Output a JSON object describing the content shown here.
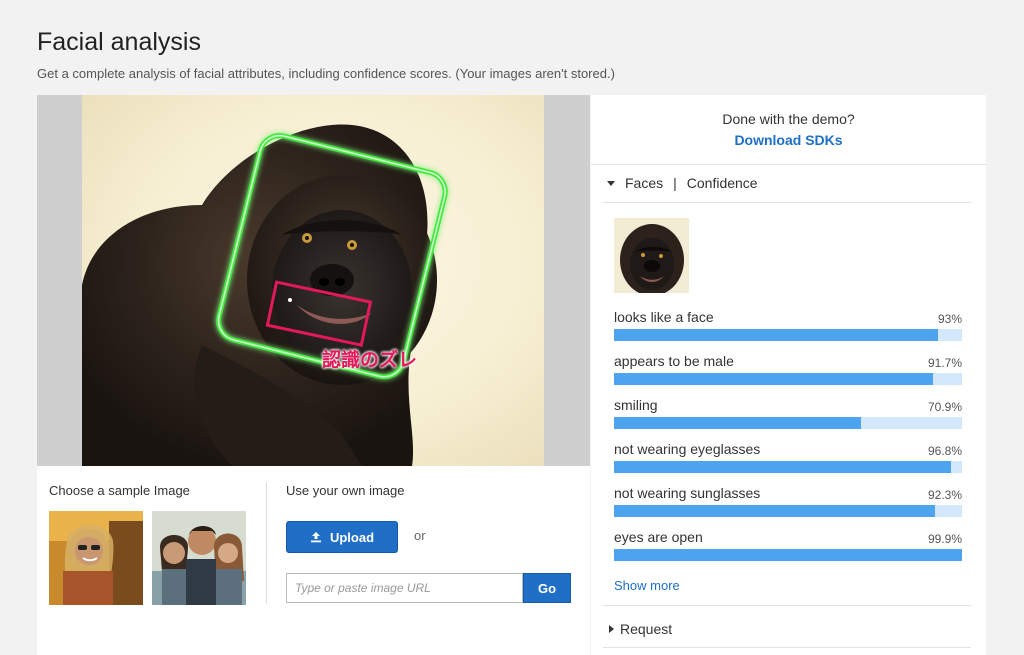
{
  "header": {
    "title": "Facial analysis",
    "subtitle": "Get a complete analysis of facial attributes, including confidence scores. (Your images aren't stored.)"
  },
  "image": {
    "annotation": "認識のズレ"
  },
  "samples": {
    "label": "Choose a sample Image"
  },
  "own_image": {
    "label": "Use your own image",
    "upload_label": "Upload",
    "or_text": "or",
    "url_placeholder": "Type or paste image URL",
    "go_label": "Go"
  },
  "demo": {
    "question": "Done with the demo?",
    "download_label": "Download SDKs"
  },
  "faces_section": {
    "title": "Faces",
    "separator": "|",
    "subtitle": "Confidence",
    "attributes": [
      {
        "label": "looks like a face",
        "value_text": "93%",
        "value": 93.0
      },
      {
        "label": "appears to be male",
        "value_text": "91.7%",
        "value": 91.7
      },
      {
        "label": "smiling",
        "value_text": "70.9%",
        "value": 70.9
      },
      {
        "label": "not wearing eyeglasses",
        "value_text": "96.8%",
        "value": 96.8
      },
      {
        "label": "not wearing sunglasses",
        "value_text": "92.3%",
        "value": 92.3
      },
      {
        "label": "eyes are open",
        "value_text": "99.9%",
        "value": 99.9
      }
    ],
    "show_more": "Show more"
  },
  "request_section": {
    "title": "Request"
  },
  "colors": {
    "accent": "#1f6fc6",
    "bar_fill": "#4ea3ee",
    "bar_track": "#d4e8fb",
    "face_box": "#3ee83a",
    "mouth_box": "#e4195a"
  }
}
